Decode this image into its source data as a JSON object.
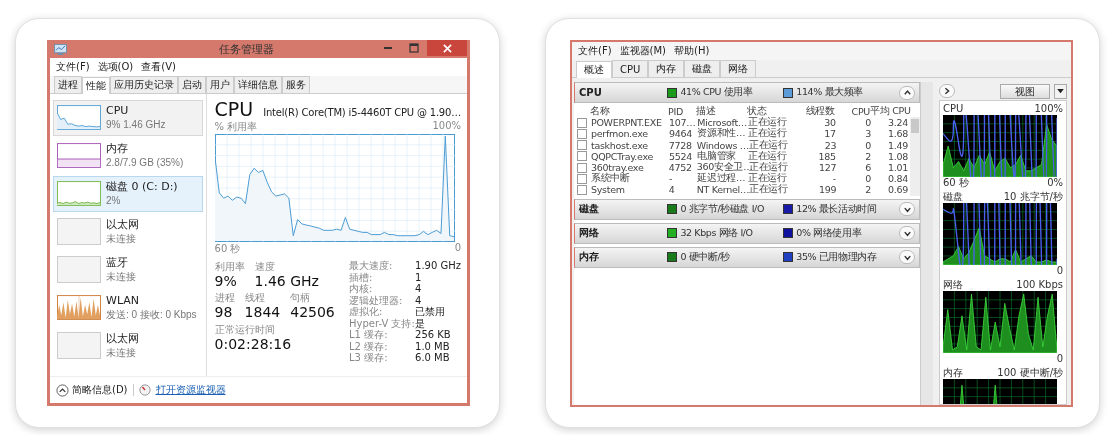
{
  "left_window": {
    "title": "任务管理器",
    "menu": [
      "文件(F)",
      "选项(O)",
      "查看(V)"
    ],
    "tabs": [
      {
        "label": "进程",
        "selected": false
      },
      {
        "label": "性能",
        "selected": true
      },
      {
        "label": "应用历史记录",
        "selected": false
      },
      {
        "label": "启动",
        "selected": false
      },
      {
        "label": "用户",
        "selected": false
      },
      {
        "label": "详细信息",
        "selected": false
      },
      {
        "label": "服务",
        "selected": false
      }
    ],
    "devices": [
      {
        "kind": "cpu",
        "name": "CPU",
        "detail": "9% 1.46 GHz",
        "selected": true,
        "highlighted": false
      },
      {
        "kind": "memory",
        "name": "内存",
        "detail": "2.8/7.9 GB (35%)",
        "selected": false,
        "highlighted": false
      },
      {
        "kind": "disk",
        "name": "磁盘 0 (C: D:)",
        "detail": "2%",
        "selected": false,
        "highlighted": true
      },
      {
        "kind": "none",
        "name": "以太网",
        "detail": "未连接",
        "selected": false,
        "highlighted": false
      },
      {
        "kind": "none",
        "name": "蓝牙",
        "detail": "未连接",
        "selected": false,
        "highlighted": false
      },
      {
        "kind": "wlan",
        "name": "WLAN",
        "detail": "发送: 0 接收: 0 Kbps",
        "selected": false,
        "highlighted": false
      },
      {
        "kind": "none",
        "name": "以太网",
        "detail": "未连接",
        "selected": false,
        "highlighted": false
      }
    ],
    "panel": {
      "title": "CPU",
      "model": "Intel(R) Core(TM) i5-4460T CPU @ 1.90…",
      "graph_label": "% 利用率",
      "graph_max": "100%",
      "graph_span": "60 秒",
      "graph_zero": "0",
      "stat_rows": [
        [
          {
            "label": "利用率",
            "value": "9%"
          },
          {
            "label": "速度",
            "value": "1.46 GHz"
          }
        ],
        [
          {
            "label": "进程",
            "value": "98"
          },
          {
            "label": "线程",
            "value": "1844"
          },
          {
            "label": "句柄",
            "value": "42506"
          }
        ],
        [
          {
            "label": "正常运行时间",
            "value": "0:02:28:16"
          }
        ]
      ],
      "specs": [
        {
          "label": "最大速度:",
          "value": "1.90 GHz"
        },
        {
          "label": "插槽:",
          "value": "1"
        },
        {
          "label": "内核:",
          "value": "4"
        },
        {
          "label": "逻辑处理器:",
          "value": "4"
        },
        {
          "label": "虚拟化:",
          "value": "已禁用"
        },
        {
          "label": "Hyper-V 支持:",
          "value": "是"
        },
        {
          "label": "L1 缓存:",
          "value": "256 KB"
        },
        {
          "label": "L2 缓存:",
          "value": "1.0 MB"
        },
        {
          "label": "L3 缓存:",
          "value": "6.0 MB"
        }
      ]
    },
    "footer": {
      "summary": "简略信息(D)",
      "link": "打开资源监视器"
    }
  },
  "right_window": {
    "menu": [
      "文件(F)",
      "监视器(M)",
      "帮助(H)"
    ],
    "tabs": [
      {
        "label": "概述",
        "selected": true
      },
      {
        "label": "CPU",
        "selected": false
      },
      {
        "label": "内存",
        "selected": false
      },
      {
        "label": "磁盘",
        "selected": false
      },
      {
        "label": "网络",
        "selected": false
      }
    ],
    "sections": [
      {
        "title": "CPU",
        "expanded": true,
        "stats": [
          {
            "text": "41% CPU 使用率",
            "color": "#1a9a1a"
          },
          {
            "text": "114% 最大频率",
            "color": "#5b9bd8"
          }
        ]
      },
      {
        "title": "磁盘",
        "expanded": false,
        "stats": [
          {
            "text": "0 兆字节/秒磁盘 I/O",
            "color": "#1a7a1a"
          },
          {
            "text": "12% 最长活动时间",
            "color": "#1a1aa8"
          }
        ]
      },
      {
        "title": "网络",
        "expanded": false,
        "stats": [
          {
            "text": "32 Kbps 网络 I/O",
            "color": "#22b022"
          },
          {
            "text": "0% 网络使用率",
            "color": "#1010a0"
          }
        ]
      },
      {
        "title": "内存",
        "expanded": false,
        "stats": [
          {
            "text": "0 硬中断/秒",
            "color": "#1a7a1a"
          },
          {
            "text": "35% 已用物理内存",
            "color": "#2040c0"
          }
        ]
      }
    ],
    "table": {
      "columns": [
        "名称",
        "PID",
        "描述",
        "状态",
        "线程数",
        "CPU",
        "平均 CPU"
      ],
      "rows": [
        {
          "checked": false,
          "cells": [
            "POWERPNT.EXE",
            "107…",
            "Microsoft…",
            "正在运行",
            "30",
            "0",
            "3.24"
          ]
        },
        {
          "checked": false,
          "cells": [
            "perfmon.exe",
            "9464",
            "资源和性…",
            "正在运行",
            "17",
            "3",
            "1.68"
          ]
        },
        {
          "checked": false,
          "cells": [
            "taskhost.exe",
            "7728",
            "Windows …",
            "正在运行",
            "23",
            "0",
            "1.49"
          ]
        },
        {
          "checked": false,
          "cells": [
            "QQPCTray.exe",
            "5524",
            "电脑管家",
            "正在运行",
            "185",
            "2",
            "1.08"
          ]
        },
        {
          "checked": false,
          "cells": [
            "360tray.exe",
            "4752",
            "360安全卫…",
            "正在运行",
            "127",
            "6",
            "1.01"
          ]
        },
        {
          "checked": false,
          "cells": [
            "系统中断",
            "-",
            "延迟过程…",
            "正在运行",
            "-",
            "0",
            "0.84"
          ]
        },
        {
          "checked": false,
          "cells": [
            "System",
            "4",
            "NT Kernel…",
            "正在运行",
            "199",
            "2",
            "0.69"
          ]
        }
      ]
    },
    "view_button": "视图",
    "graphs": [
      {
        "kind": "cpu",
        "title": "CPU",
        "max": "100%",
        "span": "60 秒",
        "min": "0%"
      },
      {
        "kind": "disk",
        "title": "磁盘",
        "max": "10 兆字节/秒",
        "min": "0"
      },
      {
        "kind": "network",
        "title": "网络",
        "max": "100 Kbps",
        "min": "0"
      },
      {
        "kind": "memory",
        "title": "内存",
        "max": "100 硬中断/秒"
      }
    ]
  }
}
